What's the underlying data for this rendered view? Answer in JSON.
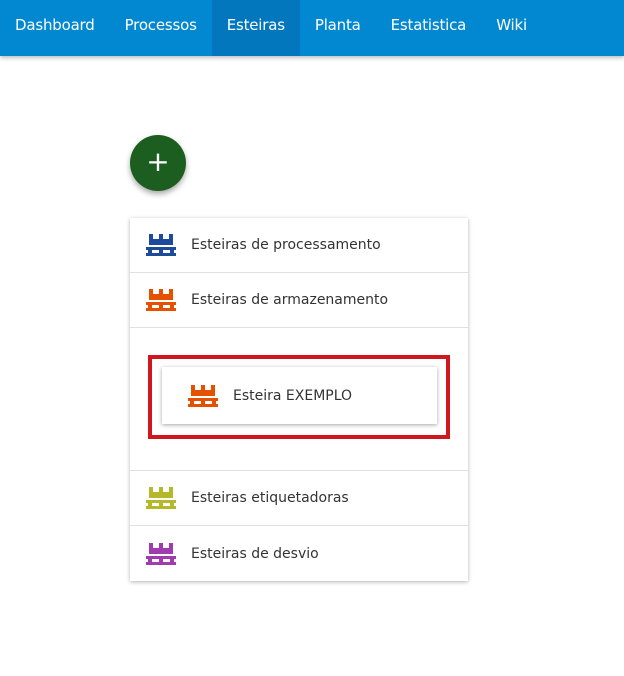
{
  "nav": {
    "items": [
      {
        "label": "Dashboard",
        "active": false
      },
      {
        "label": "Processos",
        "active": false
      },
      {
        "label": "Esteiras",
        "active": true
      },
      {
        "label": "Planta",
        "active": false
      },
      {
        "label": "Estatistica",
        "active": false
      },
      {
        "label": "Wiki",
        "active": false
      }
    ],
    "color": "#0288d1",
    "active_color": "#0277bd"
  },
  "fab": {
    "label": "+",
    "color": "#1b5e20"
  },
  "categories": [
    {
      "label": "Esteiras de processamento",
      "icon": "pallet-icon",
      "color": "#1e4a9c"
    },
    {
      "label": "Esteiras de armazenamento",
      "icon": "pallet-icon",
      "color": "#e65100",
      "expanded": true
    },
    {
      "label": "Esteiras etiquetadoras",
      "icon": "pallet-icon",
      "color": "#b5b82a"
    },
    {
      "label": "Esteiras de desvio",
      "icon": "pallet-icon",
      "color": "#a03cb0"
    }
  ],
  "expanded_item": {
    "label": "Esteira EXEMPLO",
    "icon": "pallet-icon",
    "color": "#e65100",
    "highlight_color": "#d0171d"
  }
}
